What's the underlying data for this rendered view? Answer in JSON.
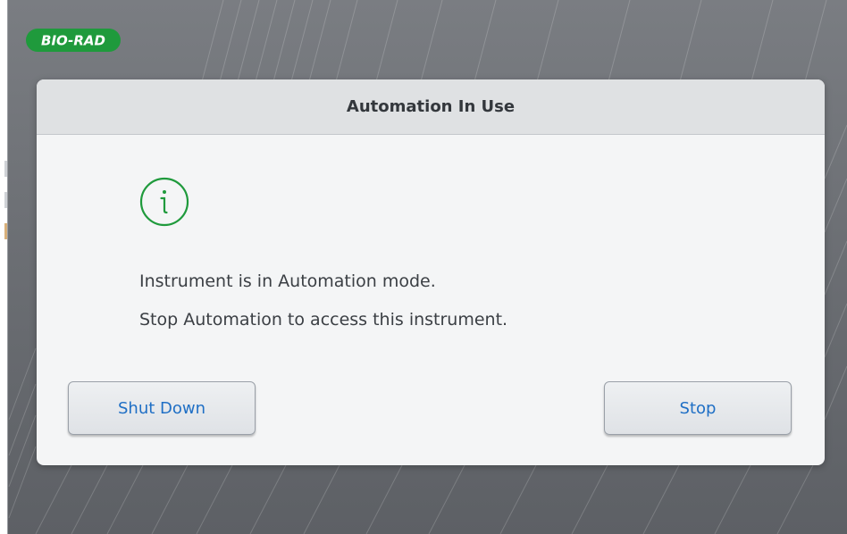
{
  "brand": {
    "logo_text": "BIO-RAD",
    "logo_color": "#1f9a3c"
  },
  "dialog": {
    "title": "Automation In Use",
    "icon": "info-icon",
    "icon_color": "#1f9a3c",
    "messages": [
      "Instrument is in Automation mode.",
      "Stop Automation to access this instrument."
    ],
    "buttons": {
      "shutdown_label": "Shut Down",
      "stop_label": "Stop"
    },
    "button_text_color": "#1f6fc5"
  }
}
